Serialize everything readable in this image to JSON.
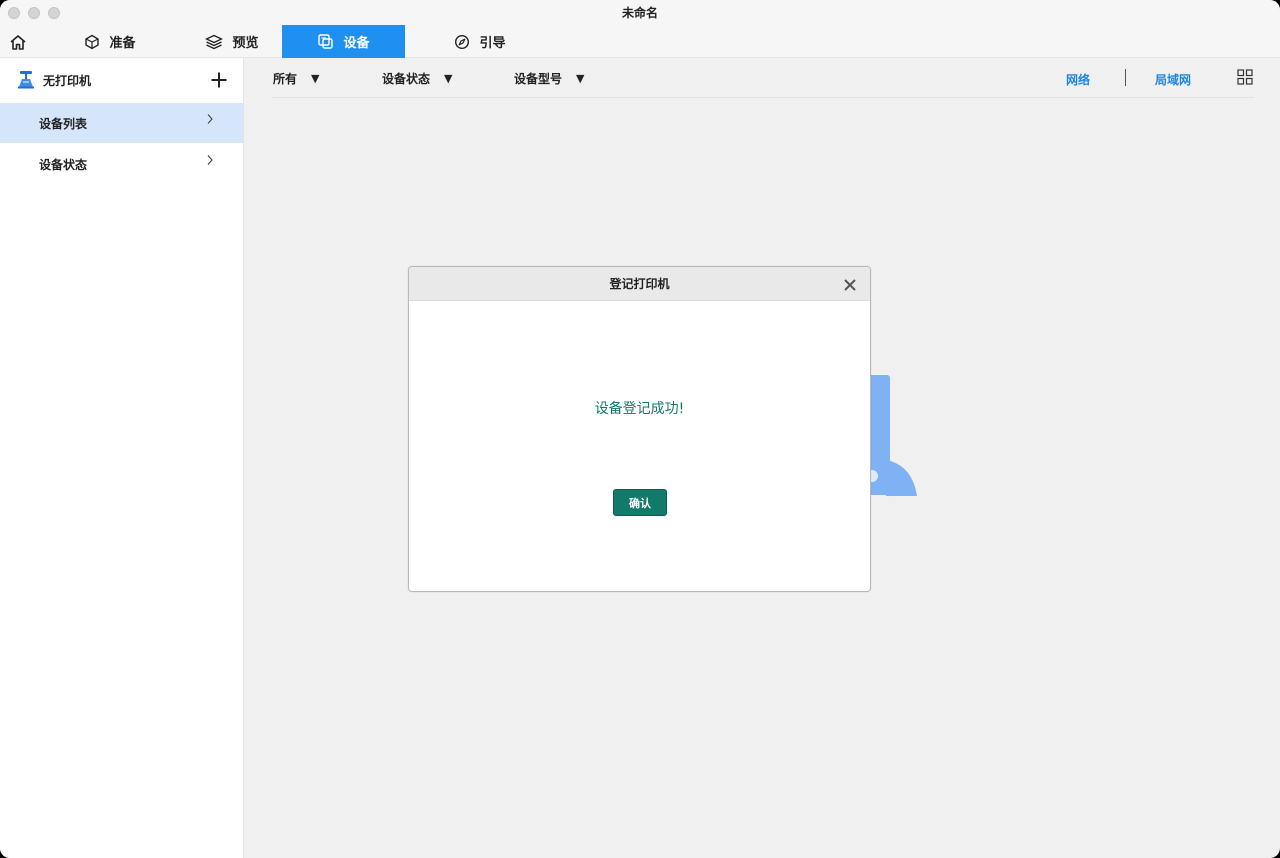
{
  "window": {
    "title": "未命名"
  },
  "tabs": [
    {
      "label": "准备",
      "icon": "cube-icon"
    },
    {
      "label": "预览",
      "icon": "layers-icon"
    },
    {
      "label": "设备",
      "icon": "device-icon",
      "active": true
    },
    {
      "label": "引导",
      "icon": "compass-icon"
    }
  ],
  "sidebar": {
    "title": "无打印机",
    "items": [
      {
        "label": "设备列表",
        "selected": true
      },
      {
        "label": "设备状态",
        "selected": false
      }
    ]
  },
  "filters": {
    "all": "所有",
    "status": "设备状态",
    "model": "设备型号",
    "arrow": "▼"
  },
  "links": {
    "network": "网络",
    "lan": "局域网"
  },
  "modal": {
    "title": "登记打印机",
    "message": "设备登记成功!",
    "confirm_label": "确认"
  },
  "colors": {
    "accent": "#1f8ff0",
    "link": "#1f86e0",
    "success_text": "#137a6b",
    "confirm_button": "#137a6b"
  }
}
